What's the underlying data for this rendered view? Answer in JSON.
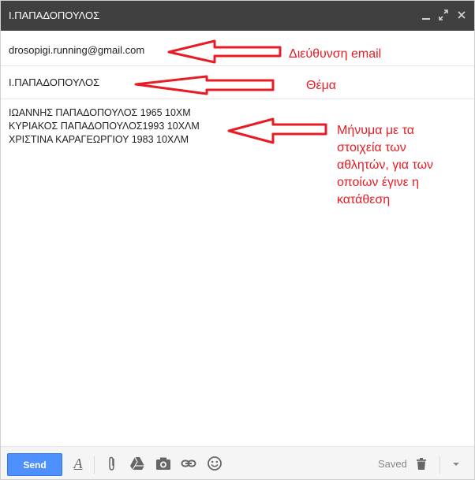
{
  "window": {
    "title": "Ι.ΠΑΠΑΔΟΠΟΥΛΟΣ",
    "controls": {
      "minimize_icon": "minimize-icon",
      "expand_icon": "expand-icon",
      "close_icon": "close-icon"
    }
  },
  "fields": {
    "to_value": "drosopigi.running@gmail.com",
    "subject_value": "Ι.ΠΑΠΑΔΟΠΟΥΛΟΣ"
  },
  "body": {
    "lines": [
      "ΙΩΑΝΝΗΣ ΠΑΠΑΔΟΠΟΥΛΟΣ 1965 10ΧΜ",
      "ΚΥΡΙΑΚΟΣ ΠΑΠΑΔΟΠΟΥΛΟΣ1993 10ΧΛΜ",
      "ΧΡΙΣΤΙΝΑ ΚΑΡΑΓΕΩΡΓΙΟΥ 1983 10ΧΛΜ"
    ]
  },
  "annotations": {
    "email_label": "Διεύθυνση email",
    "subject_label": "Θέμα",
    "message_label": "Μήνυμα με τα στοιχεία των αθλητών, για των οποίων έγινε η κατάθεση",
    "color": "#e81c24"
  },
  "toolbar": {
    "send_label": "Send",
    "saved_label": "Saved",
    "icons": [
      "format-text-icon",
      "attach-icon",
      "drive-icon",
      "photo-icon",
      "link-icon",
      "emoji-icon",
      "trash-icon",
      "more-options-icon"
    ],
    "send_color": "#4d90fe"
  }
}
